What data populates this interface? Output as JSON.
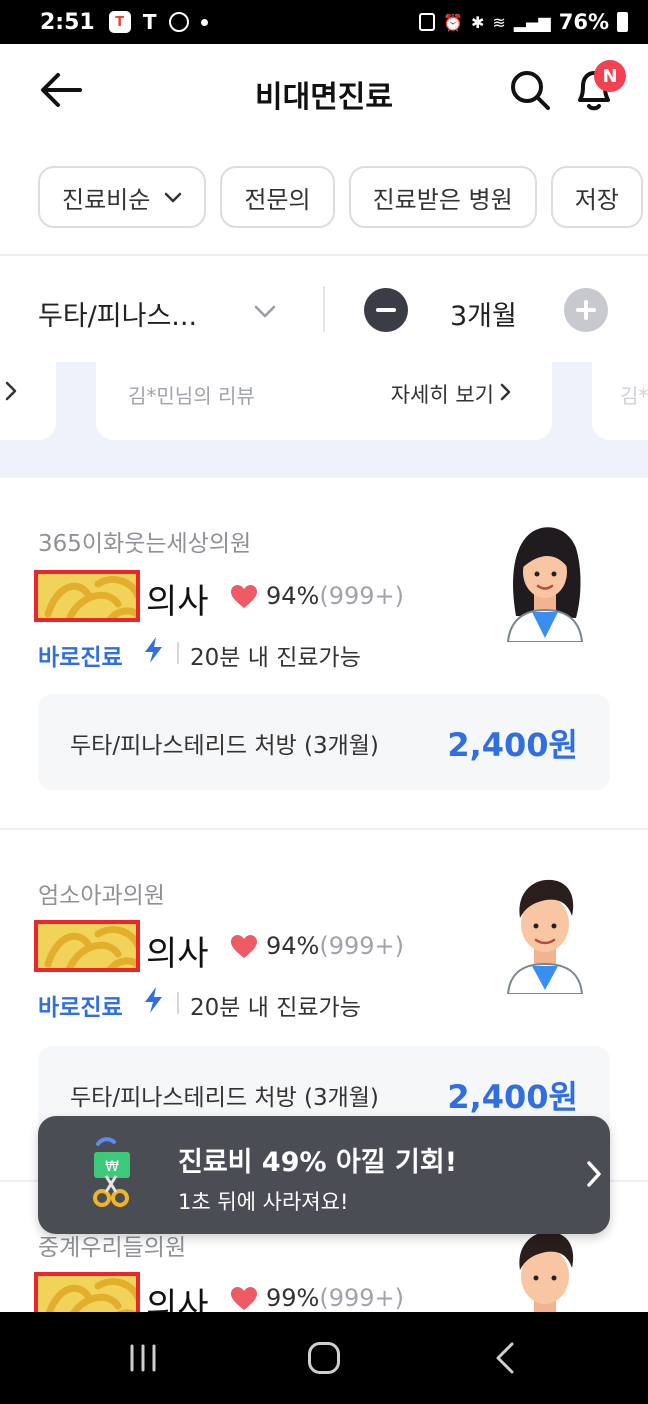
{
  "status_bar": {
    "time": "2:51",
    "battery": "76%"
  },
  "header": {
    "title": "비대면진료",
    "notification_badge": "N"
  },
  "filters": {
    "sort_label": "진료비순",
    "chips": [
      "전문의",
      "진료받은 병원",
      "저장"
    ]
  },
  "medicine_selector": {
    "medicine": "두타/피나스...",
    "period": "3개월"
  },
  "reviews": {
    "reviewer": "김*민님의 리뷰",
    "more_label": "자세히 보기",
    "next_reviewer": "김*"
  },
  "doctors": [
    {
      "clinic": "365이화웃는세상의원",
      "title": "의사",
      "rating_pct": "94%",
      "rating_count": "(999+)",
      "instant_label": "바로진료",
      "availability": "20분 내 진료가능",
      "prescription": "두타/피나스테리드 처방 (3개월)",
      "price": "2,400원",
      "avatar": "female-doctor-avatar"
    },
    {
      "clinic": "엄소아과의원",
      "title": "의사",
      "rating_pct": "94%",
      "rating_count": "(999+)",
      "instant_label": "바로진료",
      "availability": "20분 내 진료가능",
      "prescription": "두타/피나스테리드 처방 (3개월)",
      "price": "2,400원",
      "avatar": "male-doctor-avatar"
    },
    {
      "clinic": "중계우리들의원",
      "title": "의사",
      "rating_pct": "99%",
      "rating_count": "(999+)",
      "avatar": "male-doctor-avatar"
    }
  ],
  "promo": {
    "title": "진료비 49% 아낄 기회!",
    "subtitle": "1초 뒤에 사라져요!"
  },
  "colors": {
    "accent_blue": "#2f6fe0",
    "badge_red": "#f2414f",
    "heart_red": "#f05a64",
    "promo_bg": "#4b4d54"
  }
}
